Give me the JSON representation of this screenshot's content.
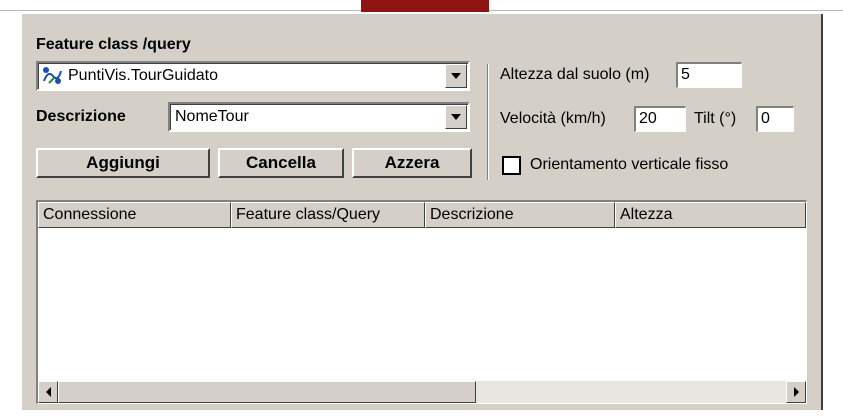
{
  "feature": {
    "label": "Feature class /query",
    "selected": "PuntiVis.TourGuidato",
    "icon": "feature-class-icon"
  },
  "descrizione": {
    "label": "Descrizione",
    "selected": "NomeTour"
  },
  "buttons": {
    "aggiungi": "Aggiungi",
    "cancella": "Cancella",
    "azzera": "Azzera"
  },
  "altezza": {
    "label": "Altezza dal suolo (m)",
    "value": "5"
  },
  "velocita": {
    "label": "Velocità (km/h)",
    "value": "20"
  },
  "tilt": {
    "label": "Tilt (°)",
    "value": "0"
  },
  "orientamento": {
    "label": "Orientamento verticale fisso",
    "checked": false
  },
  "table": {
    "columns": [
      "Connessione",
      "Feature class/Query",
      "Descrizione",
      "Altezza"
    ],
    "rows": []
  },
  "colors": {
    "face": "#d4d0c8",
    "accent": "#8d1412"
  }
}
